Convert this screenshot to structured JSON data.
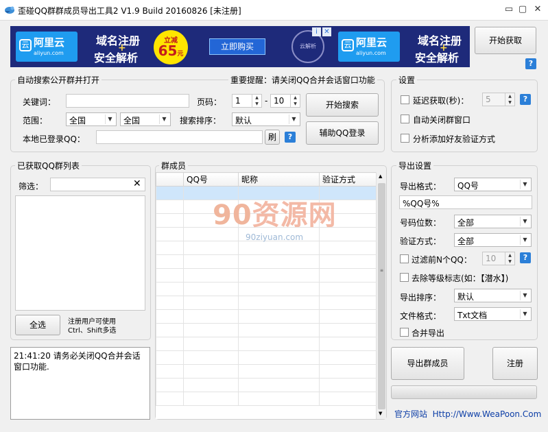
{
  "window": {
    "title": "歪碰QQ群群成员导出工具2 V1.9 Build 20160826    [未注册]",
    "minimize": "▭",
    "restore": "▢",
    "close": "✕"
  },
  "ad": {
    "logo_text": "阿里云",
    "logo_sub": "aliyun.com",
    "line1": "域名注册",
    "line2": "安全解析",
    "badge_top": "立减",
    "badge_value": "65",
    "badge_unit": "元",
    "buy_button": "立即购买",
    "seal_text": "云解析",
    "info_icon": "i",
    "close_icon": "✕"
  },
  "top_button": "开始获取",
  "search": {
    "group_title": "自动搜索公开群并打开",
    "notice": "重要提醒：请关闭QQ合并会话窗口功能",
    "keyword_label": "关键词：",
    "keyword_value": "",
    "page_label": "页码：",
    "page_from": "1",
    "page_sep": "-",
    "page_to": "10",
    "range_label": "范围：",
    "range1": "全国",
    "range2": "全国",
    "sort_label": "搜索排序：",
    "sort_value": "默认",
    "local_qq_label": "本地已登录QQ：",
    "local_qq_value": "",
    "refresh_button": "刷",
    "start_button": "开始搜索",
    "assist_button": "辅助QQ登录"
  },
  "settings": {
    "group_title": "设置",
    "delay_label": "延迟获取(秒)：",
    "delay_value": "5",
    "auto_close_label": "自动关闭群窗口",
    "analyze_label": "分析添加好友验证方式"
  },
  "group_list": {
    "title": "已获取QQ群列表",
    "filter_label": "筛选：",
    "filter_value": "",
    "clear_icon": "✕",
    "select_all": "全选",
    "hint_line1": "注册用户可使用",
    "hint_line2": "Ctrl、Shift多选"
  },
  "log": {
    "text": "21:41:20 请务必关闭QQ合并会话窗口功能."
  },
  "members": {
    "title": "群成员",
    "columns": [
      "",
      "QQ号",
      "昵称",
      "验证方式"
    ],
    "rows": 16,
    "watermark_main": "资源网",
    "watermark_num": "90",
    "watermark_sub": "90ziyuan.com"
  },
  "export": {
    "group_title": "导出设置",
    "format_label": "导出格式：",
    "format_value": "QQ号",
    "template_value": "%QQ号%",
    "digits_label": "号码位数：",
    "digits_value": "全部",
    "verify_label": "验证方式：",
    "verify_value": "全部",
    "filter_n_label": "过滤前N个QQ：",
    "filter_n_value": "10",
    "remove_level_label": "去除等级标志(如：【潜水】)",
    "sort_label": "导出排序：",
    "sort_value": "默认",
    "file_label": "文件格式：",
    "file_value": "Txt文档",
    "merge_label": "合并导出",
    "export_button": "导出群成员",
    "register_button": "注册",
    "site_label": "官方网站",
    "site_url": "Http://Www.WeaPoon.Com"
  },
  "help_icon": "?"
}
